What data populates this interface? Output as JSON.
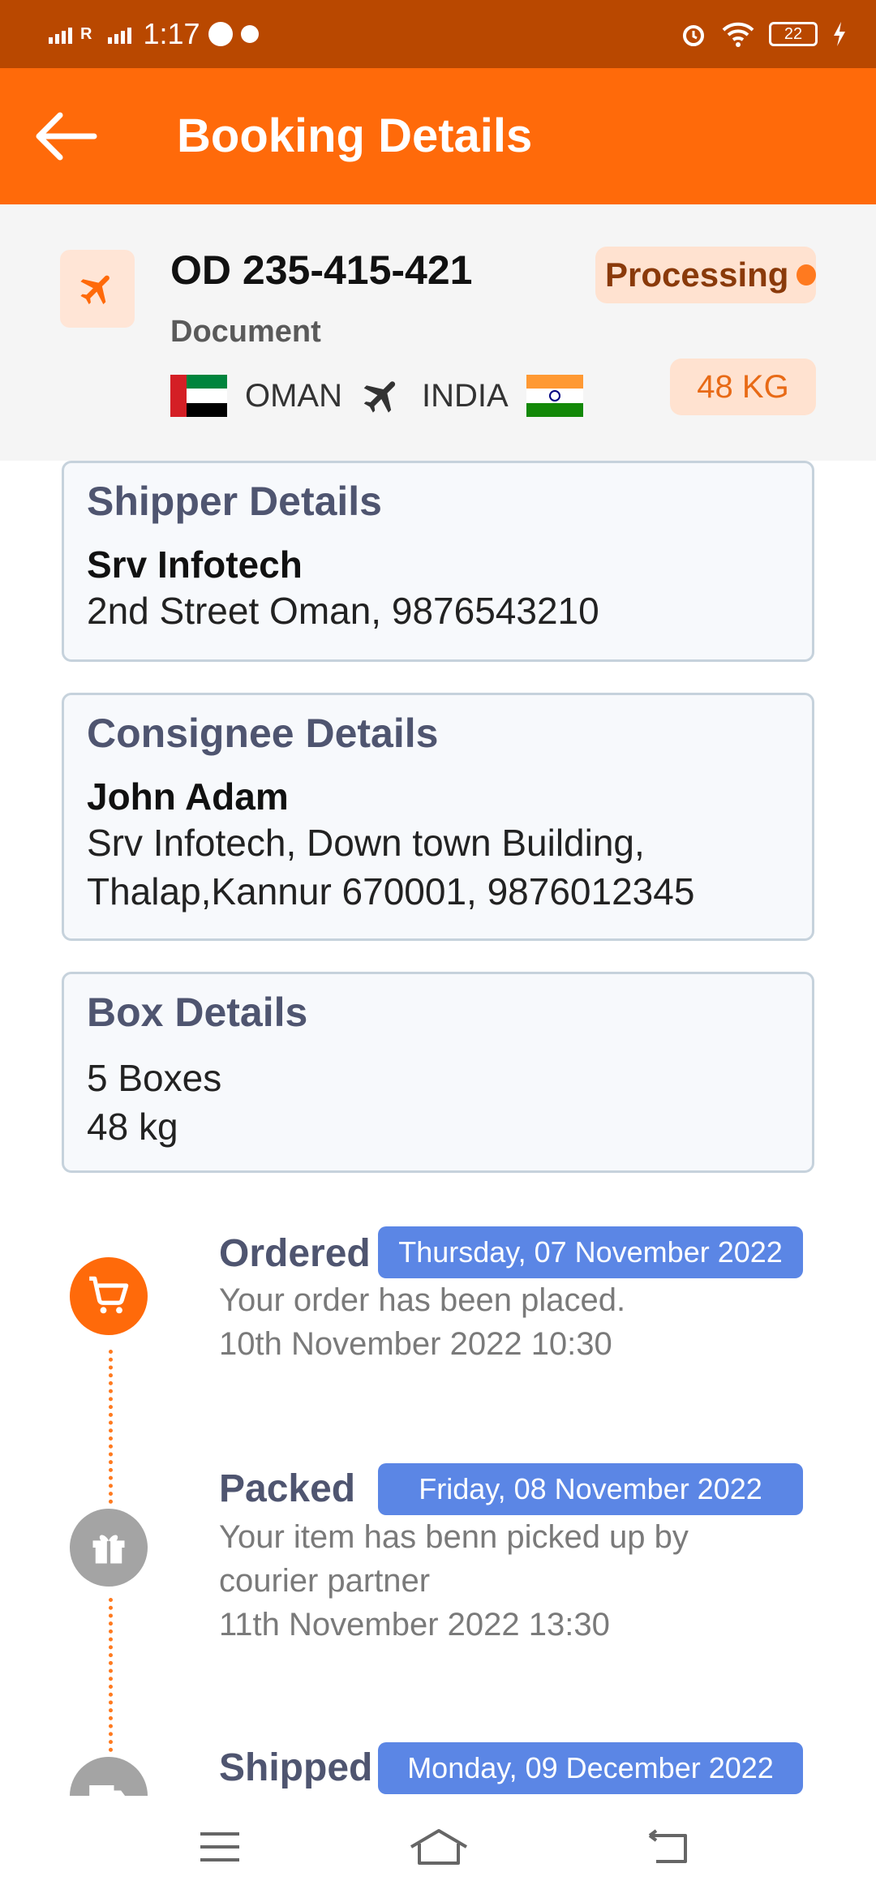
{
  "status_bar": {
    "time": "1:17",
    "sim_label": "R",
    "battery": "22"
  },
  "app_bar": {
    "title": "Booking Details"
  },
  "summary": {
    "booking_id": "OD 235-415-421",
    "type": "Document",
    "origin": "OMAN",
    "destination": "INDIA",
    "status": "Processing",
    "weight": "48 KG"
  },
  "shipper": {
    "title": "Shipper Details",
    "name": "Srv Infotech",
    "address": "2nd Street Oman, 9876543210"
  },
  "consignee": {
    "title": "Consignee Details",
    "name": "John Adam",
    "address_line1": "Srv Infotech, Down town Building,",
    "address_line2": "Thalap,Kannur 670001, 9876012345"
  },
  "box": {
    "title": "Box Details",
    "count": "5 Boxes",
    "weight": "48 kg"
  },
  "timeline": [
    {
      "title": "Ordered",
      "date": "Thursday, 07 November 2022",
      "lines": [
        "Your order has been placed.",
        "10th November 2022 10:30"
      ],
      "state": "active",
      "icon": "cart-icon"
    },
    {
      "title": "Packed",
      "date": "Friday, 08 November 2022",
      "lines": [
        "Your item has benn picked up by",
        "courier partner",
        "11th November 2022 13:30"
      ],
      "state": "inactive",
      "icon": "gift-icon"
    },
    {
      "title": "Shipped",
      "date": "Monday, 09 December 2022",
      "lines": [],
      "state": "inactive",
      "icon": "truck-icon"
    }
  ],
  "colors": {
    "primary": "#ff6a0a",
    "status_bar": "#b94800",
    "date_badge": "#5b86e5",
    "heading": "#4f5570"
  }
}
